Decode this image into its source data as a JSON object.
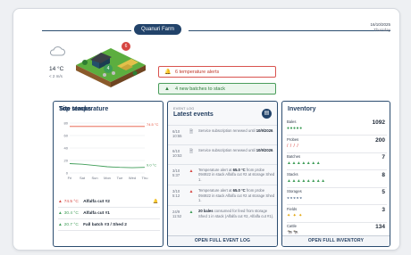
{
  "header": {
    "farm": "Quanuri Farm",
    "date": "16/10/2025",
    "day": "Thursday"
  },
  "weather": {
    "temp": "14 °C",
    "wind": "< 2 m/s"
  },
  "scene": {
    "badge_red": "6",
    "badge_green": "4"
  },
  "alerts": {
    "temperature": "6 temperature alerts",
    "batches": "4 new batches to stack"
  },
  "site": {
    "title": "Site temperature",
    "chart_data": {
      "type": "line",
      "x": [
        "Fri",
        "Sat",
        "Sun",
        "Mon",
        "Tue",
        "Wed",
        "Thu"
      ],
      "ylim": [
        0,
        80
      ],
      "yticks": [
        "80",
        "60",
        "40",
        "20",
        "0"
      ],
      "series": [
        {
          "values": [
            74.5,
            74.5,
            74.5,
            74.5,
            74.5,
            74.5,
            74.5
          ],
          "color": "#e5533d"
        },
        {
          "values": [
            15,
            14,
            12,
            10,
            9,
            8.5,
            9
          ],
          "color": "#3f9d58"
        }
      ],
      "annotations": [
        "74.5 °C",
        "9.0 °C"
      ]
    },
    "stacks_title": "Top stacks",
    "stacks": [
      {
        "temp": "74.5 °C",
        "name": "Alfalfa cut #2",
        "color": "#d64541",
        "flag": true
      },
      {
        "temp": "30.4 °C",
        "name": "Alfalfa cut #1",
        "color": "#3f9d58",
        "flag": false
      },
      {
        "temp": "20.7 °C",
        "name": "Fall batch #3 / Shed 2",
        "color": "#3f9d58",
        "flag": false
      }
    ]
  },
  "events": {
    "tag": "EVENT LOG",
    "title": "Latest events",
    "footer": "OPEN FULL EVENT LOG",
    "items": [
      {
        "date": "6/10",
        "time": "10:55",
        "icon": "doc",
        "pre": "Service subscription renewed until ",
        "bold": "10/9/2026",
        "post": "."
      },
      {
        "date": "6/10",
        "time": "10:53",
        "icon": "doc",
        "pre": "Service subscription renewed until ",
        "bold": "10/9/2026",
        "post": "."
      },
      {
        "date": "3/10",
        "time": "5:37",
        "icon": "alert",
        "pre": "Temperature alert at ",
        "bold": "65.0 °C",
        "post": " from probe 094922 in stack Alfalfa cut #2 at storage Shed 1."
      },
      {
        "date": "3/10",
        "time": "5:12",
        "icon": "alert",
        "pre": "Temperature alert at ",
        "bold": "65.0 °C",
        "post": " from probe 094922 in stack Alfalfa cut #2 at storage Shed 1."
      },
      {
        "date": "24/9",
        "time": "11:52",
        "icon": "move",
        "pre": "",
        "bold": "20 bales",
        "post": " consumed for feed from storage Shed 1 in stack (Alfalfa cut #2, Alfalfa cut #1)."
      }
    ]
  },
  "inventory": {
    "title": "Inventory",
    "footer": "OPEN FULL INVENTORY",
    "items": [
      {
        "label": "Bales",
        "count": "1092",
        "glyph": "●●●●●",
        "color": "#3f9d58"
      },
      {
        "label": "Probes",
        "count": "200",
        "glyph": "/ / / /",
        "color": "#d64541"
      },
      {
        "label": "Batches",
        "count": "7",
        "glyph": "▲▲▲▲▲▲▲",
        "color": "#3f9d58"
      },
      {
        "label": "Stacks",
        "count": "8",
        "glyph": "▲▲▲▲▲▲▲▲",
        "color": "#3f9d58"
      },
      {
        "label": "Storages",
        "count": "5",
        "glyph": "◒◒◒◒◒",
        "color": "#22436a"
      },
      {
        "label": "Fields",
        "count": "3",
        "glyph": "✦ ✦ ✦",
        "color": "#e0a000"
      },
      {
        "label": "Cattle",
        "count": "134",
        "glyph": "🐄🐄",
        "color": "#374151"
      }
    ]
  }
}
